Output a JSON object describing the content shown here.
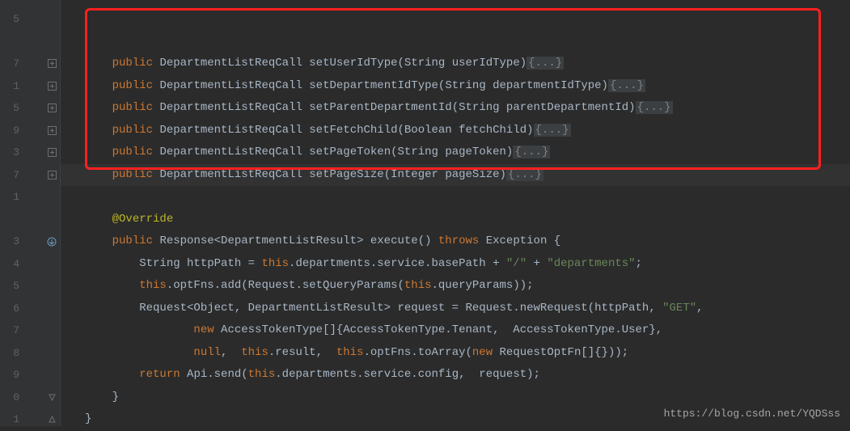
{
  "gutter": {
    "lineDigits": [
      "5",
      "",
      "7",
      "1",
      "5",
      "9",
      "3",
      "7",
      "1",
      "",
      "3",
      "4",
      "5",
      "6",
      "7",
      "8",
      "9",
      "0",
      "1"
    ]
  },
  "code": {
    "kw_public": "public",
    "type_class": "DepartmentListReqCall",
    "methods": {
      "setUserIdType": "setUserIdType",
      "setDepartmentIdType": "setDepartmentIdType",
      "setParentDepartmentId": "setParentDepartmentId",
      "setFetchChild": "setFetchChild",
      "setPageToken": "setPageToken",
      "setPageSize": "setPageSize"
    },
    "params": {
      "userIdType": "(String userIdType)",
      "departmentIdType": "(String departmentIdType)",
      "parentDepartmentId": "(String parentDepartmentId)",
      "fetchChild": "(Boolean fetchChild)",
      "pageToken": "(String pageToken)",
      "pageSize": "(Integer pageSize)"
    },
    "fold": "{...}",
    "override": "@Override",
    "exec_sig_pre": "Response<DepartmentListResult> execute() ",
    "kw_throws": "throws",
    "exec_sig_post": " Exception {",
    "l_str_decl": "        String httpPath = ",
    "kw_this": "this",
    "l_httpPath_mid": ".departments.service.basePath + ",
    "str_slash": "\"/\"",
    "plus": " + ",
    "str_dep": "\"departments\"",
    "semi": ";",
    "l_optFns": ".optFns.add(Request.setQueryParams(",
    "l_optFns_end": ".queryParams));",
    "l_req_pre": "        Request<Object, DepartmentListResult> request = Request.newRequest(httpPath, ",
    "str_get": "\"GET\"",
    "comma": ",",
    "kw_new": "new",
    "l_att": " AccessTokenType[]{AccessTokenType.Tenant,  AccessTokenType.User},",
    "kw_null": "null",
    "l_null_mid": ",  ",
    "l_result": ".result,  ",
    "l_toArr": ".optFns.toArray(",
    "l_reqOpt": " RequestOptFn[]{}));",
    "kw_return": "return",
    "l_api": " Api.send(",
    "l_cfg": ".departments.service.config,  request);",
    "brace_close1": "    }",
    "brace_close2": "}",
    "indent8": "        ",
    "indent16": "                "
  },
  "watermark": "https://blog.csdn.net/YQDSss"
}
